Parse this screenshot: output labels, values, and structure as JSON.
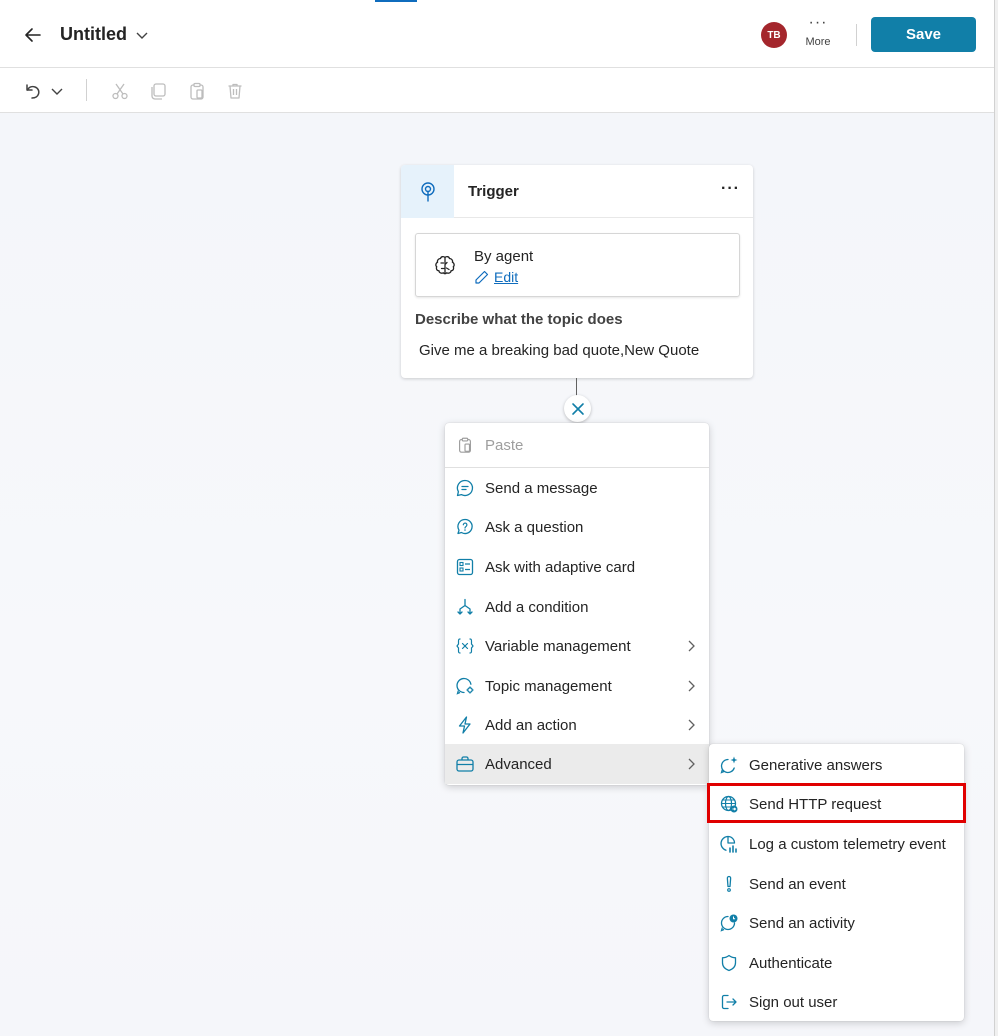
{
  "header": {
    "title": "Untitled",
    "avatar_initials": "TB",
    "more_label": "More",
    "more_dots": "···",
    "save_label": "Save"
  },
  "trigger": {
    "title": "Trigger",
    "more_dots": "···",
    "agent_label": "By agent",
    "edit_label": "Edit",
    "describe_label": "Describe what the topic does",
    "describe_value": "Give me a breaking bad quote,New Quote"
  },
  "menu": {
    "paste": "Paste",
    "items": [
      {
        "label": "Send a message",
        "icon": "message-icon"
      },
      {
        "label": "Ask a question",
        "icon": "question-icon"
      },
      {
        "label": "Ask with adaptive card",
        "icon": "adaptive-card-icon"
      },
      {
        "label": "Add a condition",
        "icon": "condition-icon"
      },
      {
        "label": "Variable management",
        "icon": "variable-icon"
      },
      {
        "label": "Topic management",
        "icon": "topic-management-icon"
      },
      {
        "label": "Add an action",
        "icon": "lightning-icon"
      },
      {
        "label": "Advanced",
        "icon": "briefcase-icon"
      }
    ]
  },
  "submenu": {
    "items": [
      {
        "label": "Generative answers",
        "icon": "sparkle-chat-icon"
      },
      {
        "label": "Send HTTP request",
        "icon": "globe-icon"
      },
      {
        "label": "Log a custom telemetry event",
        "icon": "telemetry-icon"
      },
      {
        "label": "Send an event",
        "icon": "event-icon"
      },
      {
        "label": "Send an activity",
        "icon": "activity-icon"
      },
      {
        "label": "Authenticate",
        "icon": "shield-icon"
      },
      {
        "label": "Sign out user",
        "icon": "sign-out-icon"
      }
    ]
  },
  "colors": {
    "accent": "#117fa8",
    "avatar": "#a4262c",
    "link": "#0f6cbd",
    "highlight": "#e00000"
  }
}
